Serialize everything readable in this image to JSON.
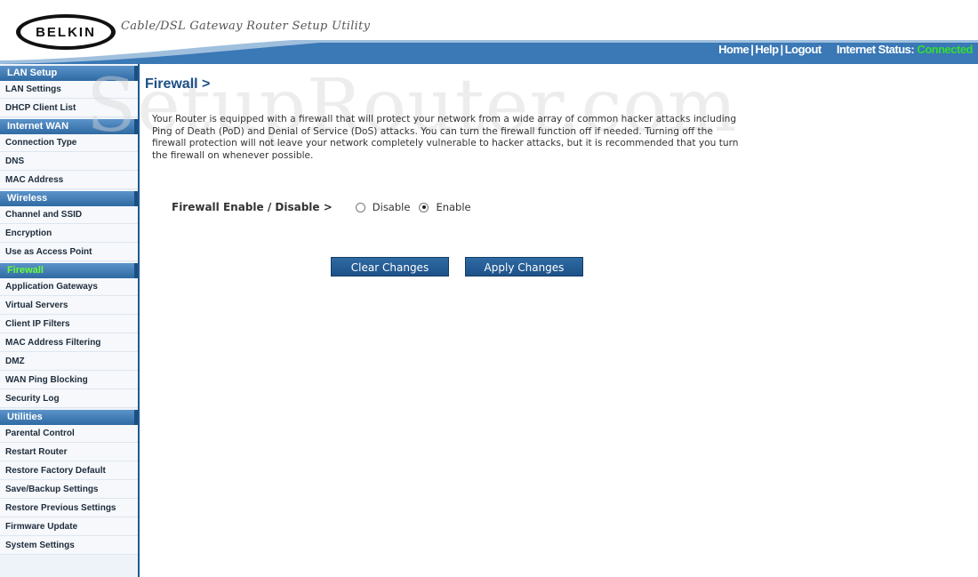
{
  "header": {
    "logo_text": "BELKIN",
    "app_title": "Cable/DSL Gateway Router Setup Utility",
    "links": {
      "home": "Home",
      "help": "Help",
      "logout": "Logout",
      "separator": "|"
    },
    "status_label": "Internet Status:",
    "status_value": "Connected"
  },
  "sidebar": {
    "sections": [
      {
        "title": "LAN Setup",
        "items": [
          "LAN Settings",
          "DHCP Client List"
        ]
      },
      {
        "title": "Internet WAN",
        "items": [
          "Connection Type",
          "DNS",
          "MAC Address"
        ]
      },
      {
        "title": "Wireless",
        "items": [
          "Channel and SSID",
          "Encryption",
          "Use as Access Point"
        ]
      },
      {
        "title": "Firewall",
        "items": [
          "Application Gateways",
          "Virtual Servers",
          "Client IP Filters",
          "MAC Address Filtering",
          "DMZ",
          "WAN Ping Blocking",
          "Security Log"
        ]
      },
      {
        "title": "Utilities",
        "items": [
          "Parental Control",
          "Restart Router",
          "Restore Factory Default",
          "Save/Backup Settings",
          "Restore Previous Settings",
          "Firmware Update",
          "System Settings"
        ]
      }
    ]
  },
  "main": {
    "watermark": "SetupRouter.com",
    "page_title": "Firewall >",
    "description": "Your Router is equipped with a firewall that will protect your network from a wide array of common hacker attacks including Ping of Death (PoD) and Denial of Service (DoS) attacks. You can turn the firewall function off if needed. Turning off the firewall protection will not leave your network completely vulnerable to hacker attacks, but it is recommended that you turn the firewall on whenever possible.",
    "firewall_label": "Firewall Enable / Disable >",
    "options": {
      "disable": "Disable",
      "enable": "Enable",
      "selected": "Enable"
    },
    "buttons": {
      "clear": "Clear Changes",
      "apply": "Apply Changes"
    }
  },
  "colors": {
    "accent_blue": "#2a68a6",
    "active_section": "#66ff33",
    "status_connected": "#33dd33"
  }
}
